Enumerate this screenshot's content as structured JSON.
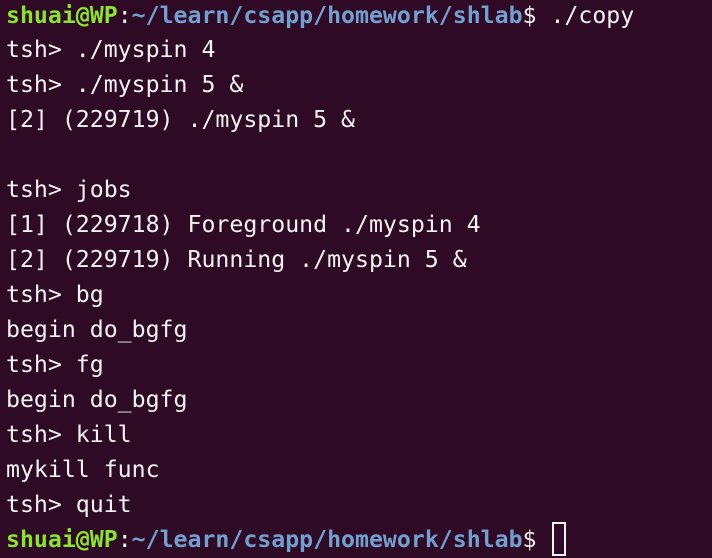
{
  "terminal": {
    "prompt_user": "shuai@WP",
    "prompt_colon": ":",
    "prompt_path": "~/learn/csapp/homework/shlab",
    "prompt_symbol": "$ ",
    "first_command": "./copy",
    "output_lines": [
      "tsh> ./myspin 4",
      "tsh> ./myspin 5 &",
      "[2] (229719) ./myspin 5 &",
      "",
      "tsh> jobs",
      "[1] (229718) Foreground ./myspin 4",
      "[2] (229719) Running ./myspin 5 &",
      "tsh> bg",
      "begin do_bgfg",
      "tsh> fg",
      "begin do_bgfg",
      "tsh> kill",
      "mykill func",
      "tsh> quit"
    ]
  },
  "colors": {
    "background": "#2f0a24",
    "foreground": "#f2f2f2",
    "prompt_user": "#8ae234",
    "prompt_path": "#729fcf"
  }
}
